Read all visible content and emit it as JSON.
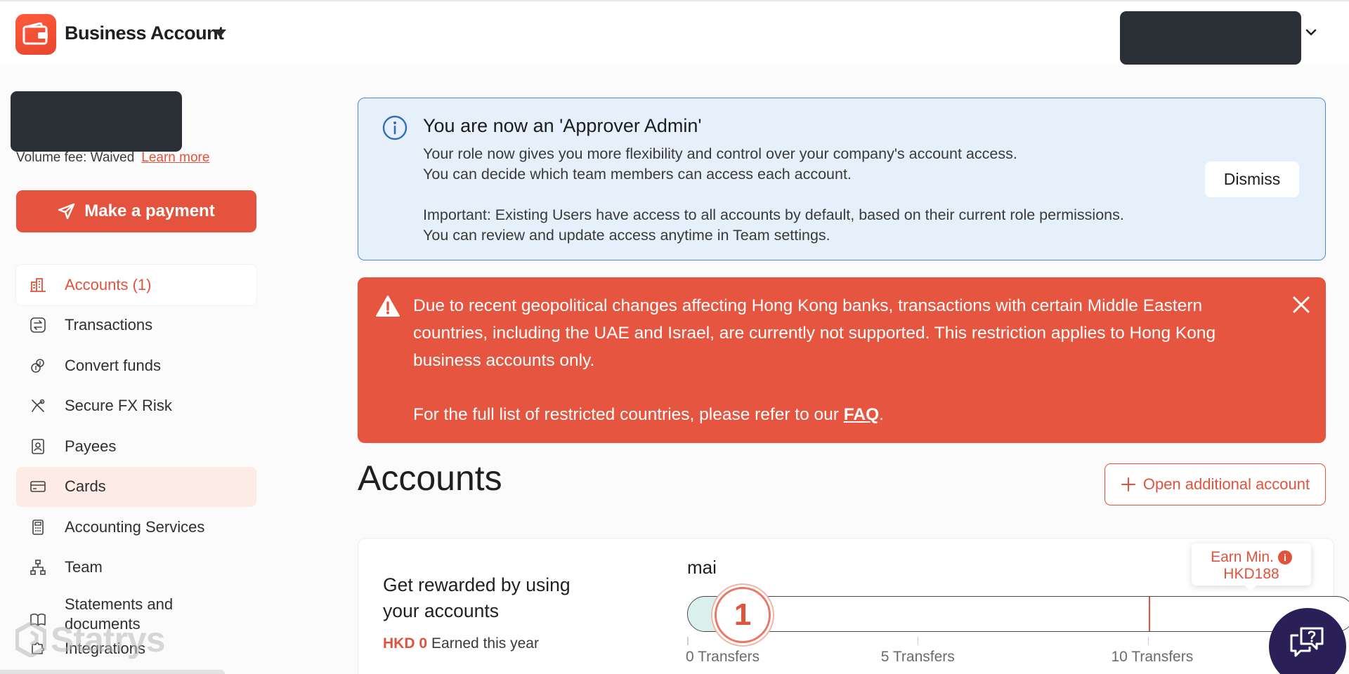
{
  "header": {
    "brand_name": "Business Account"
  },
  "sidebar": {
    "volume_fee": "Volume fee: Waived",
    "learn_more": "Learn more",
    "make_payment": "Make a payment",
    "items": [
      {
        "label": "Accounts (1)",
        "icon": "bank-icon",
        "state": "active"
      },
      {
        "label": "Transactions",
        "icon": "transfer-arrows-icon",
        "state": "normal"
      },
      {
        "label": "Convert funds",
        "icon": "currency-exchange-icon",
        "state": "normal"
      },
      {
        "label": "Secure FX Risk",
        "icon": "fx-hedge-icon",
        "state": "normal"
      },
      {
        "label": "Payees",
        "icon": "contact-card-icon",
        "state": "normal"
      },
      {
        "label": "Cards",
        "icon": "credit-card-icon",
        "state": "hover"
      },
      {
        "label": "Accounting Services",
        "icon": "calculator-icon",
        "state": "normal"
      },
      {
        "label": "Team",
        "icon": "org-chart-icon",
        "state": "normal"
      },
      {
        "label": "Statements and documents",
        "icon": "book-icon",
        "state": "normal"
      },
      {
        "label": "Integrations",
        "icon": "puzzle-icon",
        "state": "normal"
      }
    ],
    "watermark": "Statrys"
  },
  "info_banner": {
    "title": "You are now an 'Approver Admin'",
    "line1": "Your role now gives you more flexibility and control over your company's account access.",
    "line2": "You can decide which team members can access each account.",
    "line3": "Important: Existing Users have access to all accounts by default, based on their current role permissions.",
    "line4": "You can review and update access anytime in Team settings.",
    "dismiss": "Dismiss"
  },
  "warning_banner": {
    "message": "Due to recent geopolitical changes affecting Hong Kong banks, transactions with certain Middle Eastern countries, including the UAE and Israel, are currently not supported. This restriction applies to Hong Kong business accounts only.",
    "faq_prefix": "For the full list of restricted countries, please refer to our ",
    "faq_link": "FAQ",
    "faq_suffix": "."
  },
  "accounts": {
    "title": "Accounts",
    "open_button": "Open additional account"
  },
  "rewards": {
    "title": "Get rewarded by using your accounts",
    "earned_amount": "HKD 0",
    "earned_label": "Earned this year",
    "account_name": "mai",
    "current_step": "1",
    "progress_fraction": 0.052,
    "ticks": [
      {
        "label": "0 Transfers",
        "fraction": 0.0
      },
      {
        "label": "5 Transfers",
        "fraction": 0.345
      },
      {
        "label": "10 Transfers",
        "fraction": 0.69
      }
    ],
    "earn_badge_line1": "Earn Min.",
    "earn_badge_line2": "HKD188",
    "earn_marker_fraction": 0.69
  },
  "colors": {
    "brand": "#e5533e",
    "info_bg": "#e5f0fb",
    "info_border": "#4a90d9",
    "chat_bg": "#2a1f57"
  }
}
